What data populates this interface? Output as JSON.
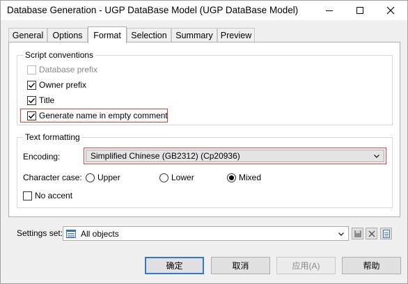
{
  "window": {
    "title": "Database Generation - UGP DataBase Model (UGP DataBase Model)"
  },
  "tabs": [
    {
      "label": "General",
      "active": false
    },
    {
      "label": "Options",
      "active": false
    },
    {
      "label": "Format",
      "active": true
    },
    {
      "label": "Selection",
      "active": false
    },
    {
      "label": "Summary",
      "active": false
    },
    {
      "label": "Preview",
      "active": false
    }
  ],
  "script_conventions": {
    "legend": "Script conventions",
    "items": [
      {
        "label": "Database prefix",
        "checked": false,
        "disabled": true
      },
      {
        "label": "Owner prefix",
        "checked": true,
        "disabled": false
      },
      {
        "label": "Title",
        "checked": true,
        "disabled": false
      },
      {
        "label": "Generate name in empty comment",
        "checked": true,
        "disabled": false,
        "highlighted": true
      }
    ]
  },
  "text_formatting": {
    "legend": "Text formatting",
    "encoding_label": "Encoding:",
    "encoding_value": "Simplified Chinese (GB2312) (Cp20936)",
    "character_case_label": "Character case:",
    "case_options": [
      {
        "label": "Upper",
        "selected": false
      },
      {
        "label": "Lower",
        "selected": false
      },
      {
        "label": "Mixed",
        "selected": true
      }
    ],
    "no_accent": {
      "label": "No accent",
      "checked": false
    }
  },
  "settings_set": {
    "label": "Settings set:",
    "value": "All objects"
  },
  "buttons": {
    "ok": "确定",
    "cancel": "取消",
    "apply": "应用(A)",
    "help": "帮助"
  },
  "colors": {
    "highlight": "#e03c3c",
    "default_button_border": "#2f78d6",
    "disabled_text": "#8a8a8a"
  }
}
